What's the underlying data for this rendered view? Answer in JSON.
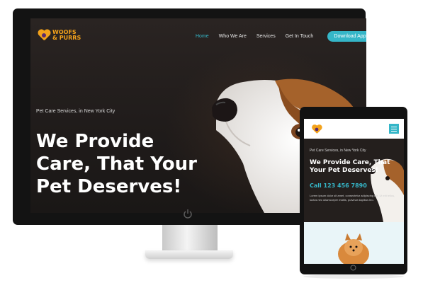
{
  "desktop": {
    "logo": {
      "line1": "WOOFS",
      "line2": "& PURRS"
    },
    "nav": {
      "home": "Home",
      "who": "Who We Are",
      "services": "Services",
      "contact": "Get In Touch"
    },
    "download_label": "Download App",
    "hero": {
      "subtitle": "Pet Care Services, in New York City",
      "headline": "We Provide Care, That Your Pet Deserves!"
    }
  },
  "tablet": {
    "hero": {
      "subtitle": "Pet Care Services, in New York City",
      "headline": "We Provide Care, That Your Pet Deserves!",
      "call": "Call 123 456 7890",
      "lorem": "Lorem ipsum dolor sit amet, consectetur adipiscing elit. Ut elit tellus, luctus nec ullamcorper mattis, pulvinar dapibus leo."
    }
  },
  "colors": {
    "accent": "#35b6c8",
    "brand": "#f3a21b",
    "dark": "#131313"
  },
  "icons": [
    "heart-paw-logo-icon",
    "power-icon",
    "menu-icon",
    "home-button-icon"
  ]
}
